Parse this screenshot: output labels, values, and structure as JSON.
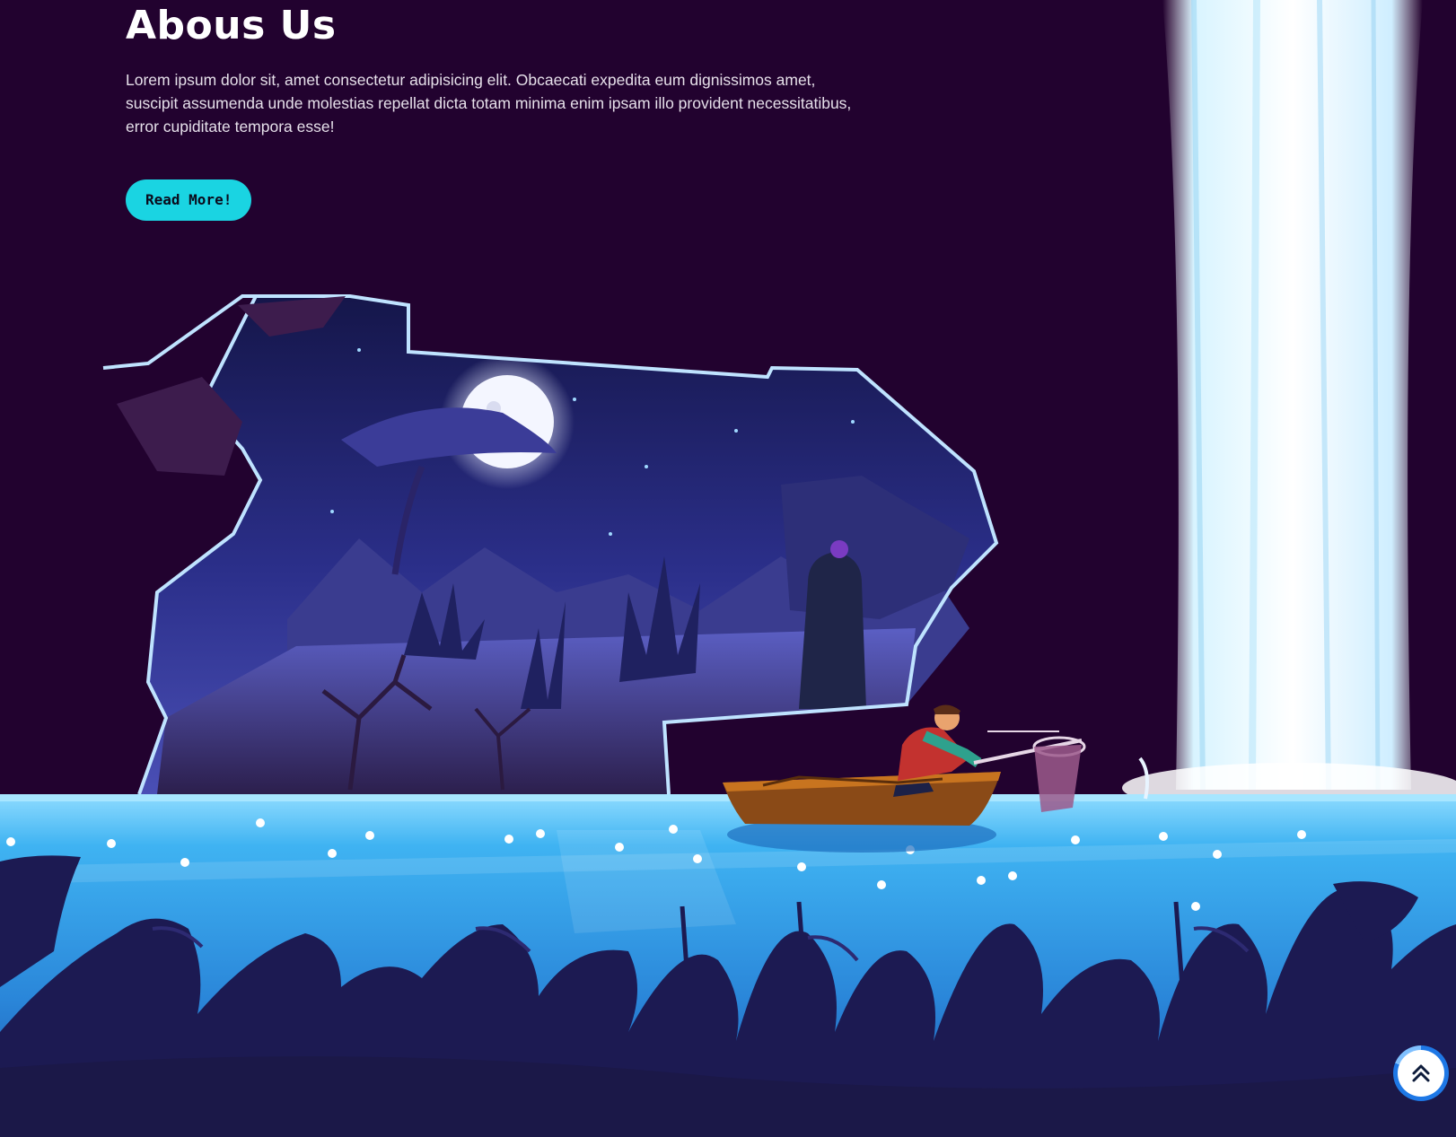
{
  "about": {
    "title": "Abous Us",
    "text": "Lorem ipsum dolor sit, amet consectetur adipisicing elit. Obcaecati expedita eum dignissimos amet, suscipit assumenda unde molestias repellat dicta totam minima enim ipsam illo provident necessitatibus, error cupiditate tempora esse!",
    "button_label": "Read More!"
  },
  "scroll_top": {
    "icon": "double-chevron-up-icon",
    "progress_percent": 81
  },
  "colors": {
    "background": "#22022f",
    "accent": "#1ad4e2",
    "water": "#3aa8ef",
    "foliage": "#1c1a52"
  }
}
